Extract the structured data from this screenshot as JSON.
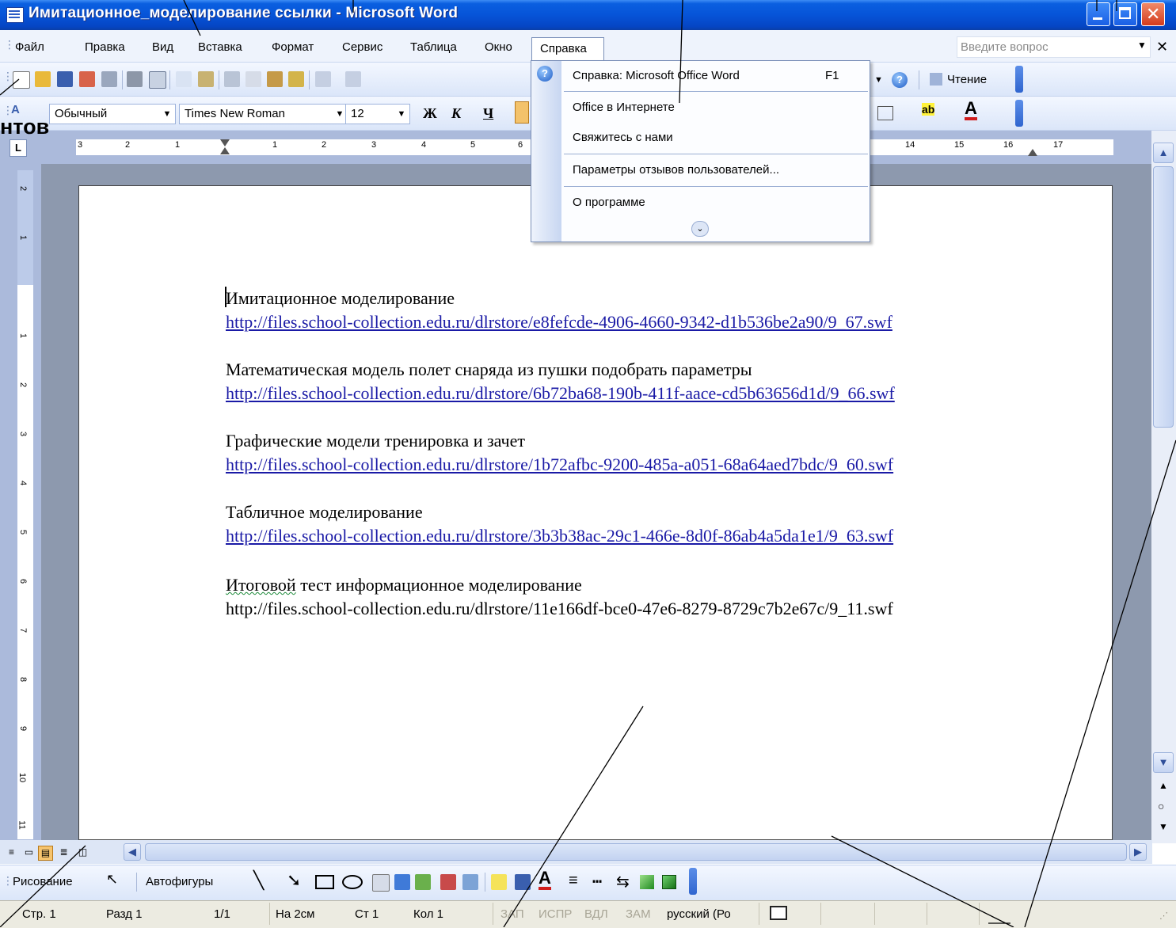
{
  "window": {
    "title": "Имитационное_моделирование ссылки - Microsoft Word"
  },
  "menubar": {
    "items": [
      "Файл",
      "Правка",
      "Вид",
      "Вставка",
      "Формат",
      "Сервис",
      "Таблица",
      "Окно",
      "Справка"
    ],
    "ask_placeholder": "Введите вопрос"
  },
  "toolbar": {
    "reading_label": "Чтение",
    "style": "Обычный",
    "font": "Times New Roman",
    "size": "12",
    "bold": "Ж",
    "italic": "К",
    "underline": "Ч"
  },
  "annotation": {
    "text": "нтов"
  },
  "help_menu": {
    "items": [
      {
        "label": "Справка: Microsoft Office Word",
        "shortcut": "F1"
      },
      {
        "label": "Office в Интернете"
      },
      {
        "label": "Свяжитесь с нами"
      },
      {
        "label": "Параметры отзывов пользователей..."
      },
      {
        "label": "О программе"
      }
    ]
  },
  "ruler": {
    "h_numbers": [
      "3",
      "2",
      "1",
      "1",
      "2",
      "3",
      "4",
      "5",
      "6",
      "14",
      "15",
      "16",
      "17"
    ],
    "v_numbers": [
      "2",
      "1",
      "1",
      "2",
      "3",
      "4",
      "5",
      "6",
      "7",
      "8",
      "9",
      "10",
      "11"
    ]
  },
  "document": {
    "lines": [
      {
        "text": "Имитационное моделирование",
        "link": false
      },
      {
        "text": "http://files.school-collection.edu.ru/dlrstore/e8fefcde-4906-4660-9342-d1b536be2a90/9_67.swf",
        "link": true
      },
      {
        "text": "Математическая модель полет снаряда из пушки подобрать параметры",
        "link": false
      },
      {
        "text": "http://files.school-collection.edu.ru/dlrstore/6b72ba68-190b-411f-aace-cd5b63656d1d/9_66.swf",
        "link": true
      },
      {
        "text": "Графические модели тренировка и зачет",
        "link": false
      },
      {
        "text": "http://files.school-collection.edu.ru/dlrstore/1b72afbc-9200-485a-a051-68a64aed7bdc/9_60.swf",
        "link": true
      },
      {
        "text": "Табличное моделирование",
        "link": false
      },
      {
        "text": "http://files.school-collection.edu.ru/dlrstore/3b3b38ac-29c1-466e-8d0f-86ab4a5da1e1/9_63.swf",
        "link": true
      },
      {
        "text_a": "Итоговой",
        "text_b": " тест информационное моделирование",
        "link": false
      },
      {
        "text": "http://files.school-collection.edu.ru/dlrstore/11e166df-bce0-47e6-8279-8729c7b2e67c/9_11.swf",
        "link": false
      }
    ]
  },
  "drawbar": {
    "draw_label": "Рисование",
    "autoshapes_label": "Автофигуры"
  },
  "statusbar": {
    "page": "Стр. 1",
    "section": "Разд 1",
    "pages": "1/1",
    "at": "На 2см",
    "line": "Ст 1",
    "col": "Кол 1",
    "rec": "ЗАП",
    "trk": "ИСПР",
    "ext": "ВДЛ",
    "ovr": "ЗАМ",
    "lang": "русский (Ро"
  },
  "colors": {
    "titlebar": "#0654d8",
    "link": "#1a1aa6",
    "page_bg": "#8d99ae"
  }
}
